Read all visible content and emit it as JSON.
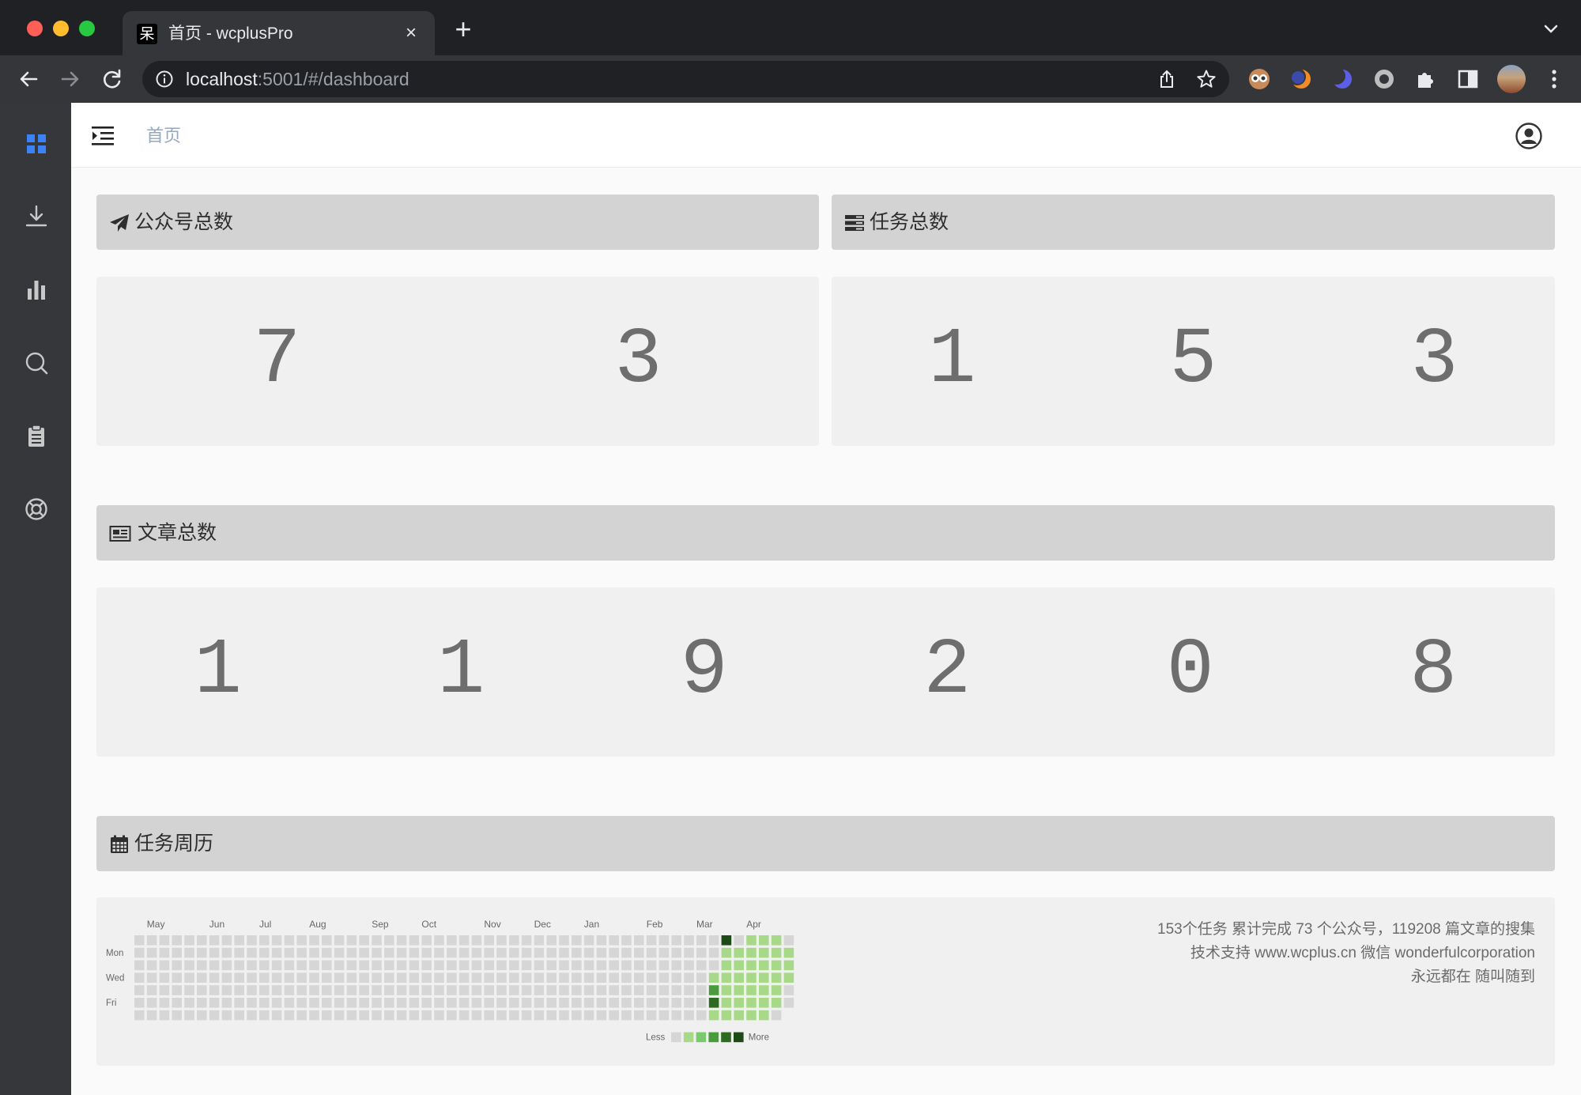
{
  "browser": {
    "tab_icon_glyph": "呆",
    "tab_title": "首页 - wcplusPro",
    "tab_close_glyph": "×",
    "new_tab_glyph": "+",
    "url_host": "localhost",
    "url_rest": ":5001/#/dashboard"
  },
  "sidebar": {
    "items": [
      {
        "icon": "dashboard-grid-icon",
        "active": true
      },
      {
        "icon": "download-icon",
        "active": false
      },
      {
        "icon": "bar-chart-icon",
        "active": false
      },
      {
        "icon": "search-icon",
        "active": false
      },
      {
        "icon": "clipboard-icon",
        "active": false
      },
      {
        "icon": "support-icon",
        "active": false
      }
    ],
    "active_color": "#3b82f6"
  },
  "header": {
    "breadcrumb": "首页"
  },
  "panels": {
    "accounts": {
      "title": "公众号总数",
      "icon": "paper-plane-icon",
      "digits": [
        "7",
        "3"
      ]
    },
    "tasks": {
      "title": "任务总数",
      "icon": "server-icon",
      "digits": [
        "1",
        "5",
        "3"
      ]
    },
    "articles": {
      "title": "文章总数",
      "icon": "newspaper-icon",
      "digits": [
        "1",
        "1",
        "9",
        "2",
        "0",
        "8"
      ]
    },
    "calendar": {
      "title": "任务周历",
      "icon": "calendar-icon"
    }
  },
  "calendar": {
    "months": [
      "May",
      "Jun",
      "Jul",
      "Aug",
      "Sep",
      "Oct",
      "Nov",
      "Dec",
      "Jan",
      "Feb",
      "Mar",
      "Apr"
    ],
    "days": [
      "Mon",
      "Wed",
      "Fri"
    ],
    "legend_less": "Less",
    "legend_more": "More",
    "colors": [
      "#d6d6d6",
      "#c6e48b",
      "#a8d989",
      "#7bc96f",
      "#4a9b3e",
      "#2e6a22",
      "#1e4a17"
    ],
    "weeks": 53,
    "active_weeks": [
      [
        0,
        0,
        0,
        0,
        0,
        0,
        0
      ],
      [
        0,
        0,
        0,
        2,
        4,
        5,
        2
      ],
      [
        6,
        2,
        2,
        2,
        2,
        2,
        2
      ],
      [
        0,
        2,
        2,
        2,
        2,
        2,
        2
      ],
      [
        2,
        2,
        2,
        2,
        2,
        2,
        2
      ],
      [
        2,
        2,
        2,
        2,
        2,
        2,
        2
      ],
      [
        2,
        2,
        2,
        2,
        2,
        2,
        0
      ],
      [
        0,
        2,
        2,
        2,
        0,
        0,
        0
      ]
    ],
    "info": [
      "153个任务 累计完成 73 个公众号，119208 篇文章的搜集",
      "技术支持 www.wcplus.cn 微信 wonderfulcorporation",
      "永远都在 随叫随到"
    ]
  }
}
